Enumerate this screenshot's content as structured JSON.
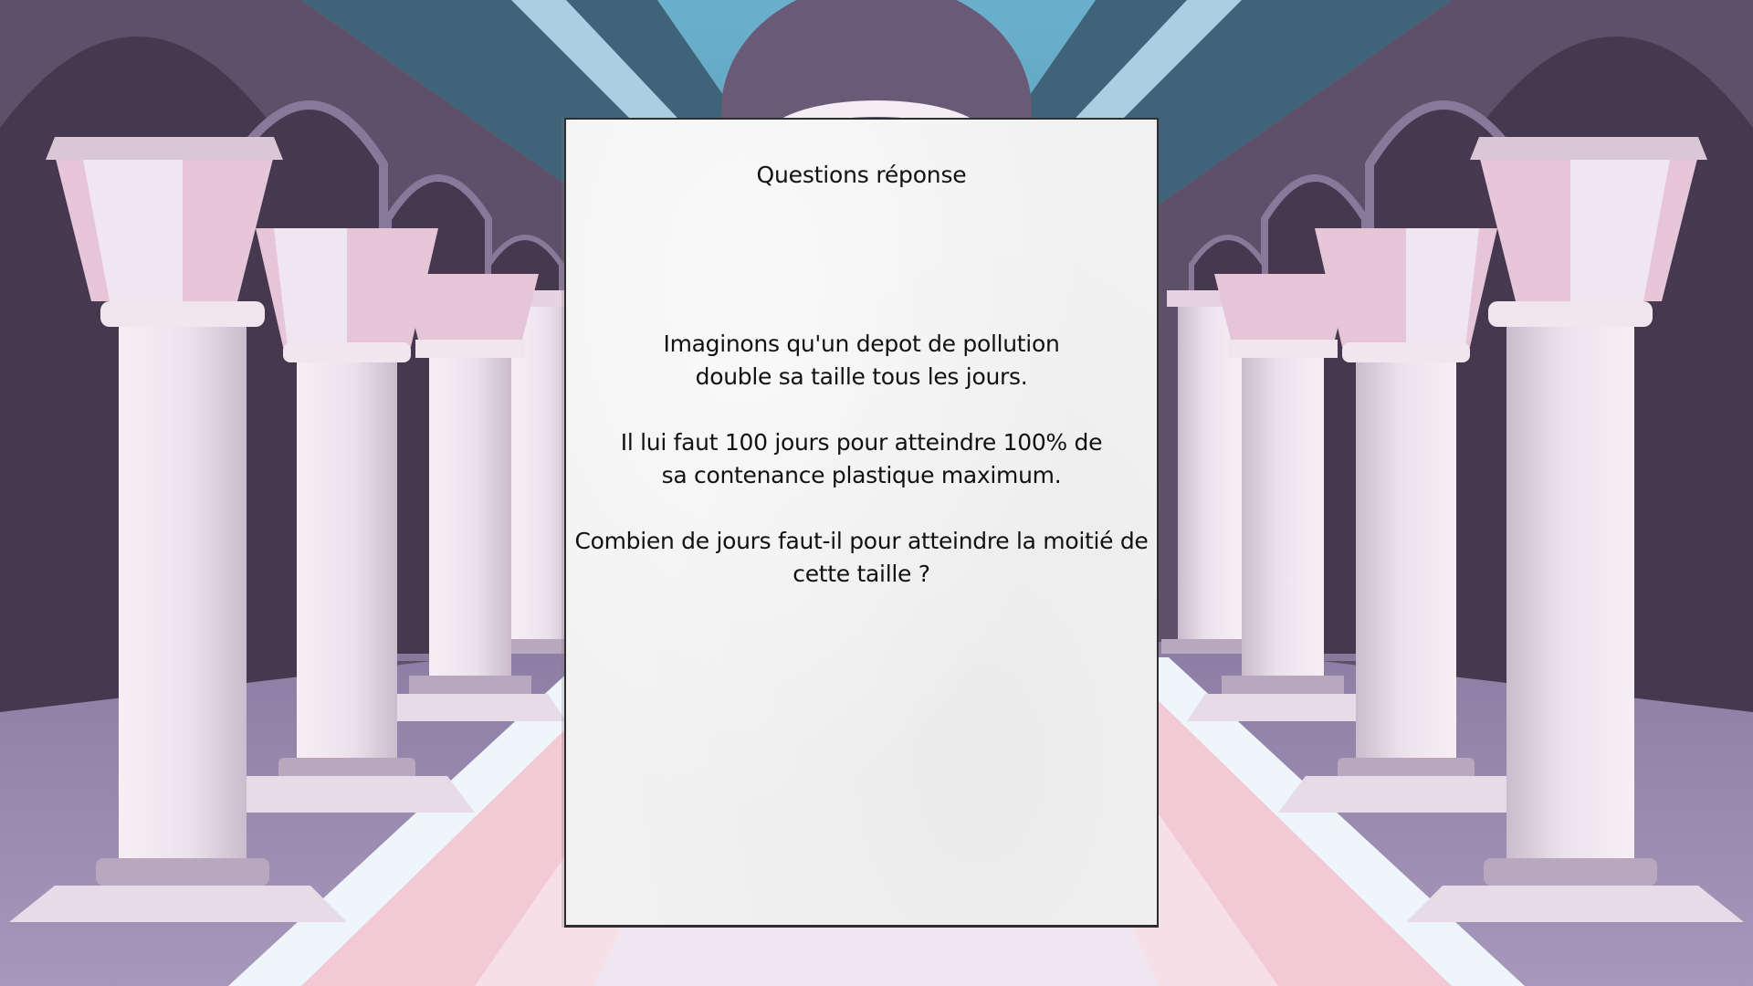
{
  "card": {
    "title": "Questions réponse",
    "paragraphs": [
      {
        "lines": [
          "Imaginons qu'un depot de pollution",
          "double sa taille tous les jours."
        ]
      },
      {
        "lines": [
          "Il lui faut 100 jours pour atteindre 100% de",
          "sa contenance plastique maximum."
        ]
      },
      {
        "lines": [
          "Combien de jours faut-il pour atteindre la moitié de",
          "cette taille ?"
        ]
      }
    ]
  },
  "colors": {
    "sky": "#5b9bb8",
    "wall": "#5e5269",
    "column": "#ece4ee",
    "column_accent": "#e5c5d6",
    "floor": "#a796b8",
    "carpet": "#f2c9d4",
    "paper": "#f1f1f1"
  }
}
